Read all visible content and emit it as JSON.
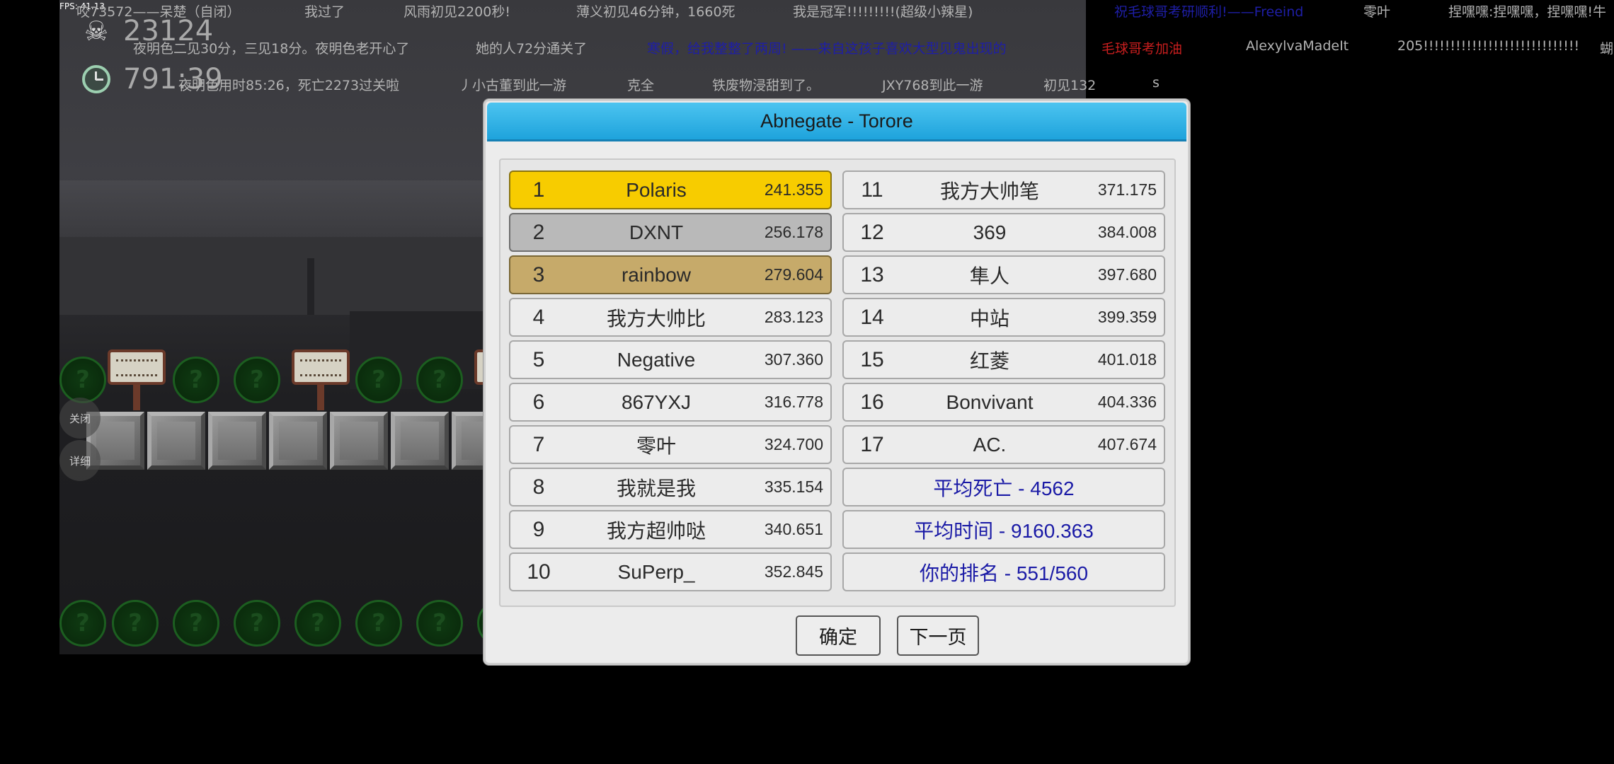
{
  "fps": "FPS: 41.13",
  "hud": {
    "deaths": "23124",
    "time": "791:39"
  },
  "side_buttons": {
    "close": "关闭",
    "detail": "详细"
  },
  "danmaku": [
    {
      "text": "夜明色二见30分，三见18分。夜明色老开心了",
      "color": "#b3b3b3"
    },
    {
      "text": "她的人72分通关了",
      "color": "#b3b3b3"
    },
    {
      "text": "毛球哥考加油",
      "color": "#c81e1e"
    },
    {
      "text": "AlexylvaMadeIt",
      "color": "#b3b3b3"
    },
    {
      "text": "205!!!!!!!!!!!!!!!!!!!!!!!!!!!!!",
      "color": "#b3b3b3"
    },
    {
      "text": "蝴",
      "color": "#b3b3b3"
    },
    {
      "text": "咬73572——呆楚（自闭）",
      "color": "#b3b3b3"
    },
    {
      "text": "我过了",
      "color": "#b3b3b3"
    },
    {
      "text": "风雨初见2200秒!",
      "color": "#b3b3b3"
    },
    {
      "text": "薄义初见46分钟，1660死",
      "color": "#b3b3b3"
    },
    {
      "text": "我是冠军!!!!!!!!!(超级小辣星)",
      "color": "#b3b3b3"
    },
    {
      "text": "祝毛球哥考研顺利!——Freeind",
      "color": "#1e1ea6"
    },
    {
      "text": "零叶",
      "color": "#b3b3b3"
    },
    {
      "text": "捏嘿嘿:捏嘿嘿，捏嘿嘿!牛",
      "color": "#b3b3b3"
    },
    {
      "text": "夜明色用时85:26，死亡2273过关啦",
      "color": "#b3b3b3"
    },
    {
      "text": "丿小古董到此一游",
      "color": "#b3b3b3"
    },
    {
      "text": "克全",
      "color": "#b3b3b3"
    },
    {
      "text": "铁废物浸甜到了。",
      "color": "#b3b3b3"
    },
    {
      "text": "JXY768到此一游",
      "color": "#b3b3b3"
    },
    {
      "text": "初见132",
      "color": "#b3b3b3"
    },
    {
      "text": "s",
      "color": "#b3b3b3"
    },
    {
      "text": "寒假，给我整整了两周! ——来自这孩子喜欢大型见鬼出现的",
      "color": "#1e1ea6"
    }
  ],
  "dialog": {
    "title": "Abnegate - Torore",
    "left_ranks": [
      {
        "rank": "1",
        "name": "Polaris",
        "score": "241.355",
        "medal": "gold"
      },
      {
        "rank": "2",
        "name": "DXNT",
        "score": "256.178",
        "medal": "silver"
      },
      {
        "rank": "3",
        "name": "rainbow",
        "score": "279.604",
        "medal": "bronze"
      },
      {
        "rank": "4",
        "name": "我方大帅比",
        "score": "283.123",
        "medal": "none"
      },
      {
        "rank": "5",
        "name": "Negative",
        "score": "307.360",
        "medal": "none"
      },
      {
        "rank": "6",
        "name": "867YXJ",
        "score": "316.778",
        "medal": "none"
      },
      {
        "rank": "7",
        "name": "零叶",
        "score": "324.700",
        "medal": "none"
      },
      {
        "rank": "8",
        "name": "我就是我",
        "score": "335.154",
        "medal": "none"
      },
      {
        "rank": "9",
        "name": "我方超帅哒",
        "score": "340.651",
        "medal": "none"
      },
      {
        "rank": "10",
        "name": "SuPerp_",
        "score": "352.845",
        "medal": "none"
      }
    ],
    "right_ranks": [
      {
        "rank": "11",
        "name": "我方大帅笔",
        "score": "371.175"
      },
      {
        "rank": "12",
        "name": "369",
        "score": "384.008"
      },
      {
        "rank": "13",
        "name": "隼人",
        "score": "397.680"
      },
      {
        "rank": "14",
        "name": "中站",
        "score": "399.359"
      },
      {
        "rank": "15",
        "name": "红菱",
        "score": "401.018"
      },
      {
        "rank": "16",
        "name": "Bonvivant",
        "score": "404.336"
      },
      {
        "rank": "17",
        "name": "AC.",
        "score": "407.674"
      }
    ],
    "stats": {
      "avg_deaths": "平均死亡 - 4562",
      "avg_time": "平均时间 - 9160.363",
      "your_rank": "你的排名 - 551/560"
    },
    "buttons": {
      "confirm": "确定",
      "next_page": "下一页"
    },
    "stat_color": "#1a1aa6"
  },
  "colors": {
    "header_blue": "#1ea3dc",
    "gold": "#f7cc00",
    "silver": "#b9b9b9",
    "bronze": "#c6aa6a"
  }
}
